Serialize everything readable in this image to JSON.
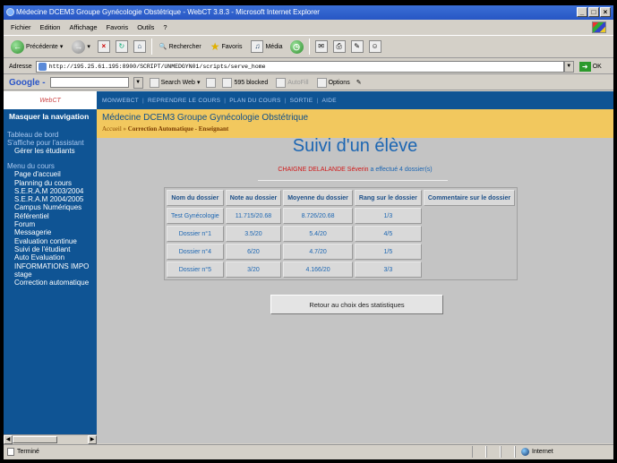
{
  "window": {
    "title": "Médecine DCEM3 Groupe Gynécologie Obstétrique - WebCT 3.8.3 - Microsoft Internet Explorer",
    "buttons": [
      "_",
      "□",
      "×"
    ]
  },
  "menubar": {
    "items": [
      "Fichier",
      "Edition",
      "Affichage",
      "Favoris",
      "Outils",
      "?"
    ]
  },
  "toolbar": {
    "back_label": "Précédente",
    "search_label": "Rechercher",
    "favorites_label": "Favoris",
    "media_label": "Média"
  },
  "addressbar": {
    "label": "Adresse",
    "url": "http://195.25.61.195:8900/SCRIPT/UNMEDGYN01/scripts/serve_home",
    "go_label": "OK"
  },
  "googlebar": {
    "logo": "Google -",
    "search_web_label": "Search Web",
    "blocked_label": "595 blocked",
    "autofill_label": "AutoFill",
    "options_label": "Options"
  },
  "sidebar": {
    "logo_text": "WebCT",
    "hide_nav_label": "Masquer la navigation",
    "sections": [
      {
        "title": "Tableau de bord",
        "subtitle": "S'affiche pour l'assistant",
        "items": [
          "Gérer les étudiants"
        ]
      },
      {
        "title": "Menu du cours",
        "items": [
          "Page d'accueil",
          "Planning du cours",
          "S.E.R.A.M 2003/2004",
          "S.E.R.A.M 2004/2005",
          "Campus Numériques",
          "Référentiel",
          "Forum",
          "Messagerie",
          "Evaluation continue",
          "Suivi de l'étudiant",
          "Auto Evaluation",
          "INFORMATIONS IMPO",
          "stage",
          "Correction automatique"
        ]
      }
    ]
  },
  "topnav": {
    "items": [
      "MONWEBCT",
      "REPRENDRE LE COURS",
      "PLAN DU COURS",
      "SORTIE",
      "AIDE"
    ]
  },
  "header": {
    "course_title": "Médecine DCEM3 Groupe Gynécologie Obstétrique",
    "breadcrumb_home": "Accueil",
    "breadcrumb_sep": "»",
    "breadcrumb_current": "Correction Automatique - Enseignant"
  },
  "page": {
    "title": "Suivi d'un élève",
    "student_name": "CHAIGNE DELALANDE Séverin",
    "student_suffix": " a effectué 4 dossier(s)"
  },
  "table": {
    "headers": [
      "Nom du dossier",
      "Note au dossier",
      "Moyenne du dossier",
      "Rang sur le dossier",
      "Commentaire sur le dossier"
    ],
    "rows": [
      [
        "Test Gynécologie",
        "11.715/20.68",
        "8.726/20.68",
        "1/3",
        ""
      ],
      [
        "Dossier n°1",
        "3.5/20",
        "5.4/20",
        "4/5",
        ""
      ],
      [
        "Dossier n°4",
        "6/20",
        "4.7/20",
        "1/5",
        ""
      ],
      [
        "Dossier n°5",
        "3/20",
        "4.166/20",
        "3/3",
        ""
      ]
    ]
  },
  "back_button": {
    "label": "Retour au choix des statistiques"
  },
  "statusbar": {
    "text": "Terminé",
    "zone": "Internet"
  }
}
